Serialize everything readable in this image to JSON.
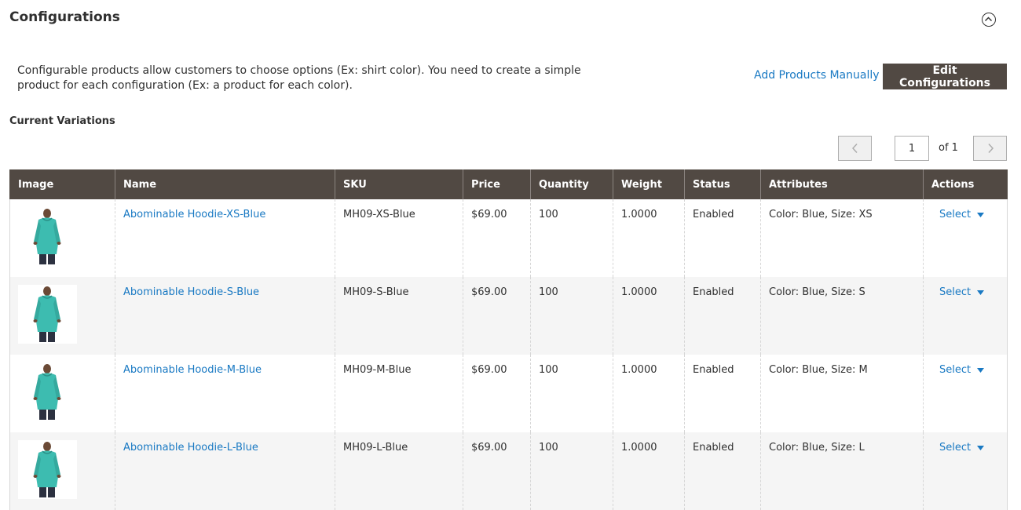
{
  "section": {
    "title": "Configurations",
    "description": "Configurable products allow customers to choose options (Ex: shirt color). You need to create a simple product for each configuration (Ex: a product for each color).",
    "add_manually": "Add Products Manually",
    "edit_configurations": "Edit Configurations",
    "current_variations": "Current Variations"
  },
  "pager": {
    "current": "1",
    "of_label": "of 1"
  },
  "table": {
    "headers": [
      "Image",
      "Name",
      "SKU",
      "Price",
      "Quantity",
      "Weight",
      "Status",
      "Attributes",
      "Actions"
    ],
    "rows": [
      {
        "name": "Abominable Hoodie-XS-Blue",
        "sku": "MH09-XS-Blue",
        "price": "$69.00",
        "quantity": "100",
        "weight": "1.0000",
        "status": "Enabled",
        "attributes": "Color: Blue, Size: XS",
        "action": "Select"
      },
      {
        "name": "Abominable Hoodie-S-Blue",
        "sku": "MH09-S-Blue",
        "price": "$69.00",
        "quantity": "100",
        "weight": "1.0000",
        "status": "Enabled",
        "attributes": "Color: Blue, Size: S",
        "action": "Select"
      },
      {
        "name": "Abominable Hoodie-M-Blue",
        "sku": "MH09-M-Blue",
        "price": "$69.00",
        "quantity": "100",
        "weight": "1.0000",
        "status": "Enabled",
        "attributes": "Color: Blue, Size: M",
        "action": "Select"
      },
      {
        "name": "Abominable Hoodie-L-Blue",
        "sku": "MH09-L-Blue",
        "price": "$69.00",
        "quantity": "100",
        "weight": "1.0000",
        "status": "Enabled",
        "attributes": "Color: Blue, Size: L",
        "action": "Select"
      }
    ]
  },
  "icons": {
    "collapse": "chevron-up-circle-icon",
    "prev": "chevron-left-icon",
    "next": "chevron-right-icon",
    "dropdown": "caret-down-icon"
  },
  "colors": {
    "header_bg": "#514943",
    "link": "#1979c3",
    "button_bg": "#514943",
    "hoodie": "#3dbcb0"
  }
}
